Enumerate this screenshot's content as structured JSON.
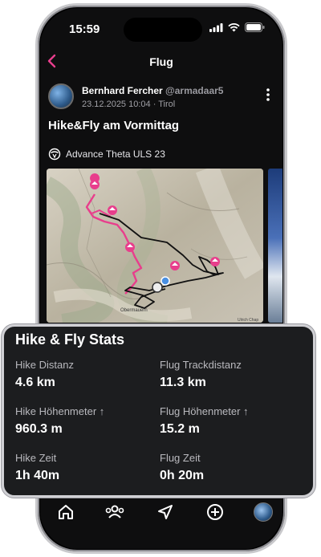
{
  "status": {
    "time": "15:59"
  },
  "nav": {
    "title": "Flug"
  },
  "post": {
    "author": "Bernhard Fercher",
    "handle": "@armadaar5",
    "meta": "23.12.2025 10:04 · Tirol",
    "title": "Hike&Fly am Vormittag",
    "glider": "Advance Theta ULS 23"
  },
  "map": {
    "labels": {
      "town": "Obermauern",
      "credit": "Ulrich Chap"
    },
    "accent": "#e83e8c"
  },
  "stats": {
    "title": "Hike & Fly Stats",
    "hike_distance": {
      "label": "Hike Distanz",
      "value": "4.6 km"
    },
    "flight_track": {
      "label": "Flug Trackdistanz",
      "value": "11.3 km"
    },
    "hike_elevation": {
      "label": "Hike Höhenmeter ↑",
      "value": "960.3 m"
    },
    "flight_elevation": {
      "label": "Flug Höhenmeter ↑",
      "value": "15.2 m"
    },
    "hike_time": {
      "label": "Hike Zeit",
      "value": "1h 40m"
    },
    "flight_time": {
      "label": "Flug Zeit",
      "value": "0h 20m"
    }
  },
  "tabbar": {
    "items": [
      "home-icon",
      "people-icon",
      "navigation-icon",
      "add-icon",
      "profile-avatar"
    ]
  }
}
